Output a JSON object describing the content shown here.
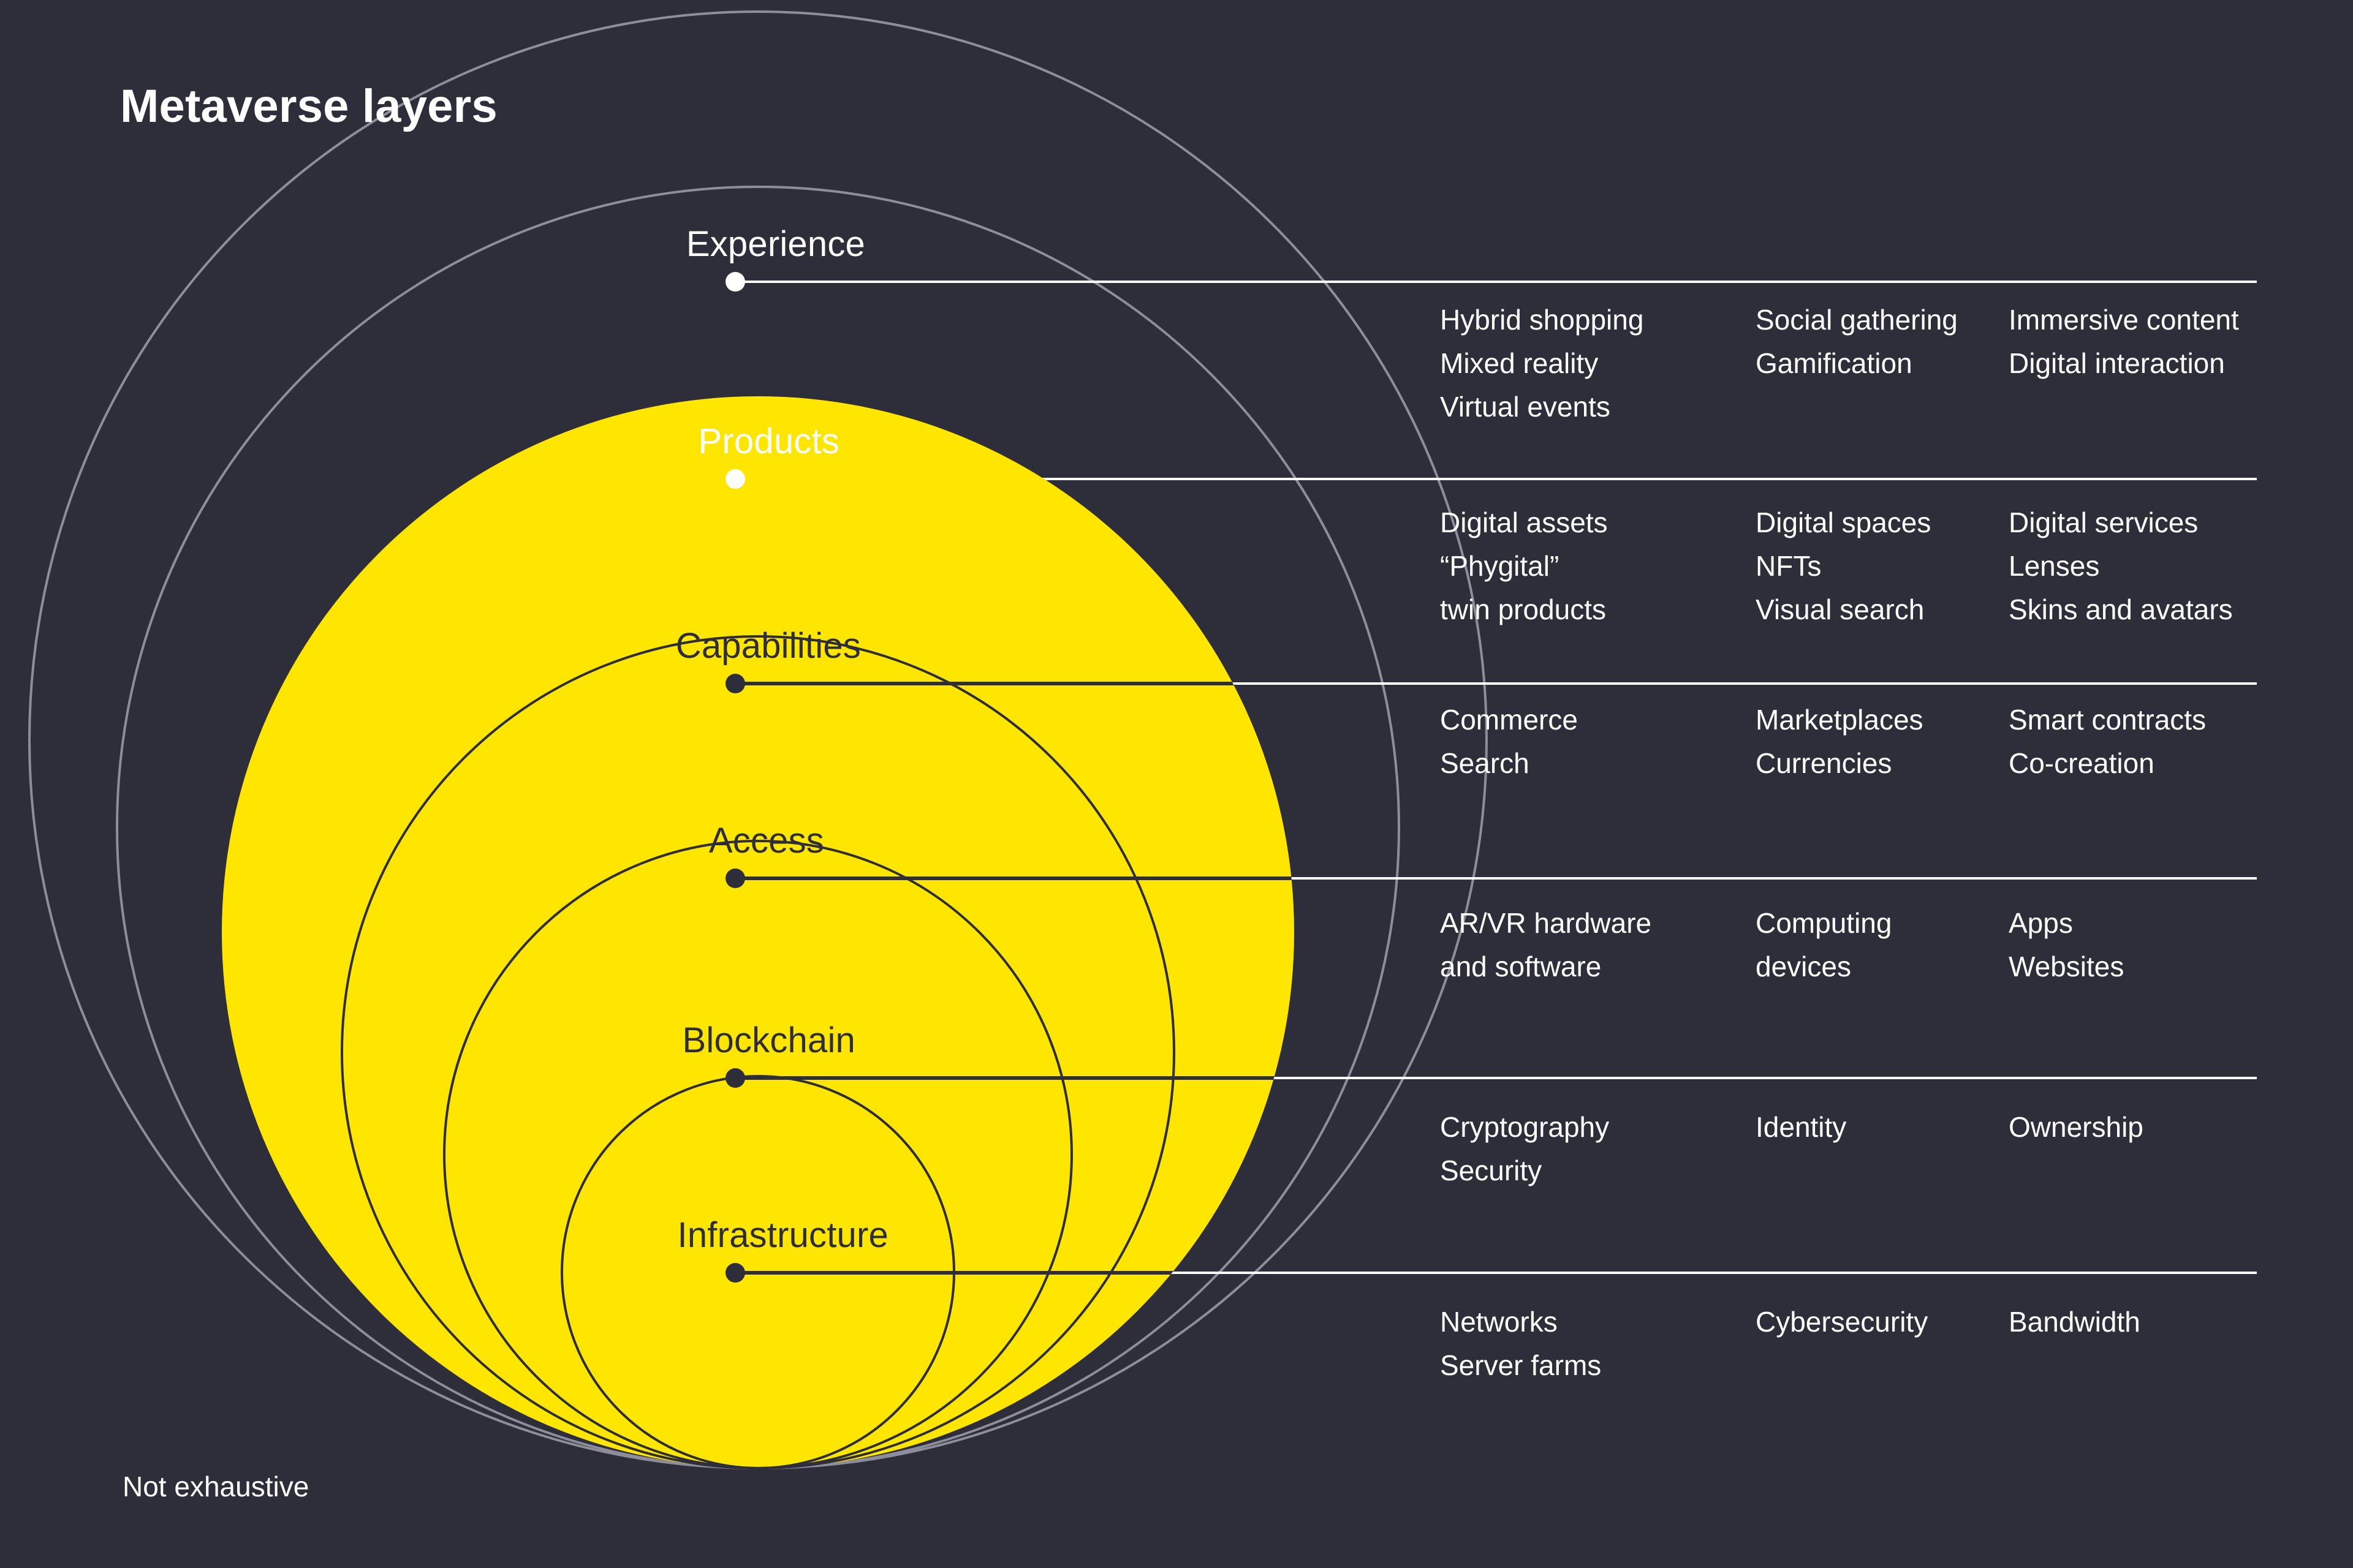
{
  "page": {
    "title": "Metaverse layers",
    "footnote": "Not exhaustive",
    "background_color": "#2e2e3a",
    "accent_color": "#ffe600",
    "text_color": "#ffffff",
    "dark_text_color": "#2e2e3a"
  },
  "chart_data": {
    "type": "diagram",
    "subtype": "concentric-circles-with-callouts",
    "title": "Metaverse layers",
    "note": "Not exhaustive",
    "layers": [
      {
        "name": "Experience",
        "filled": false,
        "label_color": "#ffffff",
        "columns": [
          [
            "Hybrid shopping",
            "Mixed reality",
            "Virtual events"
          ],
          [
            "Social gathering",
            "Gamification"
          ],
          [
            "Immersive content",
            "Digital interaction"
          ]
        ]
      },
      {
        "name": "Products",
        "filled": false,
        "label_color": "#ffffff",
        "columns": [
          [
            "Digital assets",
            "“Phygital”",
            "twin products"
          ],
          [
            "Digital spaces",
            "NFTs",
            "Visual search"
          ],
          [
            "Digital services",
            "Lenses",
            "Skins and avatars"
          ]
        ]
      },
      {
        "name": "Capabilities",
        "filled": true,
        "label_color": "#2e2e3a",
        "columns": [
          [
            "Commerce",
            "Search"
          ],
          [
            "Marketplaces",
            "Currencies"
          ],
          [
            "Smart contracts",
            "Co-creation"
          ]
        ]
      },
      {
        "name": "Access",
        "filled": true,
        "label_color": "#2e2e3a",
        "columns": [
          [
            "AR/VR hardware",
            "and software"
          ],
          [
            "Computing",
            "devices"
          ],
          [
            "Apps",
            "Websites"
          ]
        ]
      },
      {
        "name": "Blockchain",
        "filled": true,
        "label_color": "#2e2e3a",
        "columns": [
          [
            "Cryptography",
            "Security"
          ],
          [
            "Identity"
          ],
          [
            "Ownership"
          ]
        ]
      },
      {
        "name": "Infrastructure",
        "filled": true,
        "label_color": "#2e2e3a",
        "columns": [
          [
            "Networks",
            "Server farms"
          ],
          [
            "Cybersecurity"
          ],
          [
            "Bandwidth"
          ]
        ]
      }
    ]
  },
  "rows": {
    "experience": {
      "label": "Experience",
      "col1": "Hybrid shopping\nMixed reality\nVirtual events",
      "col2": "Social gathering\nGamification",
      "col3": "Immersive content\nDigital interaction"
    },
    "products": {
      "label": "Products",
      "col1": "Digital assets\n“Phygital”\ntwin products",
      "col2": "Digital spaces\nNFTs\nVisual search",
      "col3": "Digital services\nLenses\nSkins and avatars"
    },
    "capabilities": {
      "label": "Capabilities",
      "col1": "Commerce\nSearch",
      "col2": "Marketplaces\nCurrencies",
      "col3": "Smart contracts\nCo-creation"
    },
    "access": {
      "label": "Access",
      "col1": "AR/VR hardware\nand software",
      "col2": "Computing\ndevices",
      "col3": "Apps\nWebsites"
    },
    "blockchain": {
      "label": "Blockchain",
      "col1": "Cryptography\nSecurity",
      "col2": "Identity",
      "col3": "Ownership"
    },
    "infrastructure": {
      "label": "Infrastructure",
      "col1": "Networks\nServer farms",
      "col2": "Cybersecurity",
      "col3": "Bandwidth"
    }
  }
}
